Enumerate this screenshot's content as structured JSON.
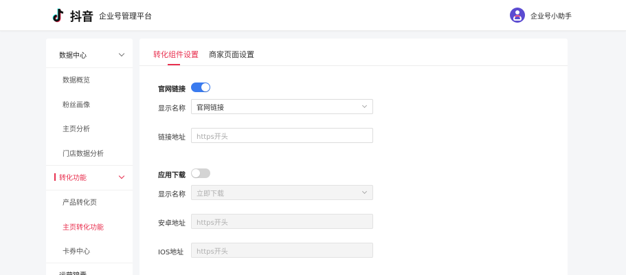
{
  "header": {
    "logo_text": "抖音",
    "platform_name": "企业号管理平台",
    "user_name": "企业号小助手"
  },
  "sidebar": {
    "groups": [
      {
        "label": "数据中心",
        "items": [
          "数据概览",
          "粉丝画像",
          "主页分析",
          "门店数据分析"
        ]
      },
      {
        "label": "转化功能",
        "items": [
          "产品转化页",
          "主页转化功能",
          "卡券中心"
        ]
      },
      {
        "label": "运营锦囊",
        "items": []
      }
    ]
  },
  "tabs": [
    "转化组件设置",
    "商家页面设置"
  ],
  "website_link": {
    "title": "官网链接",
    "enabled": true,
    "display_name_label": "显示名称",
    "display_name_value": "官网链接",
    "url_label": "链接地址",
    "url_placeholder": "https开头"
  },
  "app_download": {
    "title": "应用下载",
    "enabled": false,
    "display_name_label": "显示名称",
    "display_name_value": "立即下载",
    "android_label": "安卓地址",
    "android_placeholder": "https开头",
    "ios_label": "IOS地址",
    "ios_placeholder": "https开头"
  },
  "colors": {
    "accent": "#e8304f",
    "toggle_on": "#3a7bef",
    "toggle_off": "#d4d4d4"
  }
}
